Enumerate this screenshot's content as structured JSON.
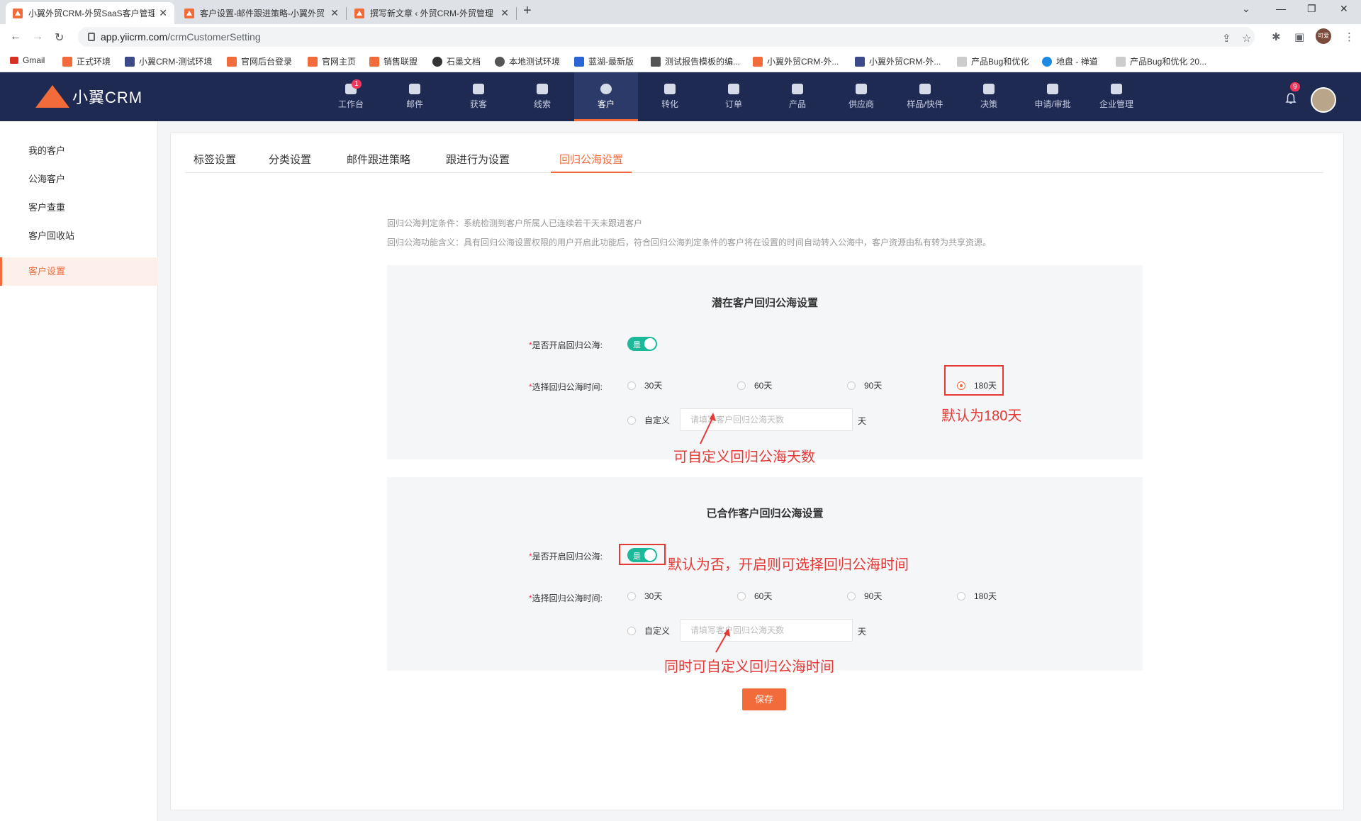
{
  "browser": {
    "tabs": [
      {
        "title": "小翼外贸CRM-外贸SaaS客户管理",
        "close": "✕"
      },
      {
        "title": "客户设置-邮件跟进策略-小翼外贸",
        "close": "✕"
      },
      {
        "title": "撰写新文章 ‹ 外贸CRM-外贸管理",
        "close": "✕"
      }
    ],
    "new_tab": "+",
    "url_host": "app.yiicrm.com",
    "url_path": "/crmCustomerSetting",
    "profile_label": "可爱",
    "bookmarks": [
      {
        "label": "Gmail",
        "color": "#d93025"
      },
      {
        "label": "正式环境",
        "color": "#f26b3a"
      },
      {
        "label": "小翼CRM-测试环境",
        "color": "#3c4a8a"
      },
      {
        "label": "官网后台登录",
        "color": "#f26b3a"
      },
      {
        "label": "官网主页",
        "color": "#f26b3a"
      },
      {
        "label": "销售联盟",
        "color": "#f26b3a"
      },
      {
        "label": "石墨文档",
        "color": "#333333"
      },
      {
        "label": "本地测试环境",
        "color": "#555555"
      },
      {
        "label": "蓝湖-最新版",
        "color": "#2a65d8"
      },
      {
        "label": "测试报告模板的编...",
        "color": "#555555"
      },
      {
        "label": "小翼外贸CRM-外...",
        "color": "#f26b3a"
      },
      {
        "label": "小翼外贸CRM-外...",
        "color": "#3c4a8a"
      },
      {
        "label": "产品Bug和优化",
        "color": "#cccccc"
      },
      {
        "label": "地盘 - 禅道",
        "color": "#1e88e5"
      },
      {
        "label": "产品Bug和优化 20...",
        "color": "#cccccc"
      }
    ]
  },
  "header": {
    "logo_text": "小翼CRM",
    "nav": [
      {
        "label": "工作台",
        "badge": "1"
      },
      {
        "label": "邮件"
      },
      {
        "label": "获客"
      },
      {
        "label": "线索"
      },
      {
        "label": "客户"
      },
      {
        "label": "转化"
      },
      {
        "label": "订单"
      },
      {
        "label": "产品"
      },
      {
        "label": "供应商"
      },
      {
        "label": "样品/快件"
      },
      {
        "label": "决策"
      },
      {
        "label": "申请/审批"
      },
      {
        "label": "企业管理"
      }
    ],
    "bell_badge": "9"
  },
  "sidebar": {
    "items": [
      {
        "label": "我的客户"
      },
      {
        "label": "公海客户"
      },
      {
        "label": "客户查重"
      },
      {
        "label": "客户回收站"
      },
      {
        "label": "客户设置"
      }
    ]
  },
  "settings_tabs": [
    "标签设置",
    "分类设置",
    "邮件跟进策略",
    "跟进行为设置",
    "回归公海设置"
  ],
  "description": {
    "line1": "回归公海判定条件：系统检测到客户所属人已连续若干天未跟进客户",
    "line2": "回归公海功能含义：具有回归公海设置权限的用户开启此功能后，符合回归公海判定条件的客户将在设置的时间自动转入公海中，客户资源由私有转为共享资源。"
  },
  "potential": {
    "title": "潜在客户回归公海设置",
    "enable_label": "是否开启回归公海:",
    "switch_text": "是",
    "time_label": "选择回归公海时间:",
    "options": [
      "30天",
      "60天",
      "90天",
      "180天"
    ],
    "selected_index": 3,
    "custom_label": "自定义",
    "custom_placeholder": "请填写客户回归公海天数",
    "unit": "天"
  },
  "cooperated": {
    "title": "已合作客户回归公海设置",
    "enable_label": "是否开启回归公海:",
    "switch_text": "是",
    "time_label": "选择回归公海时间:",
    "options": [
      "30天",
      "60天",
      "90天",
      "180天"
    ],
    "custom_label": "自定义",
    "custom_placeholder": "请填写客户回归公海天数",
    "unit": "天"
  },
  "annotations": {
    "default_180": "默认为180天",
    "custom_days": "可自定义回归公海天数",
    "default_no": "默认为否，开启则可选择回归公海时间",
    "custom_time": "同时可自定义回归公海时间"
  },
  "save_label": "保存",
  "required_mark": "*",
  "colors": {
    "accent": "#f26b3a",
    "header_bg": "#1e2a52",
    "switch_on": "#1bb99a",
    "annotation": "#e53935"
  }
}
